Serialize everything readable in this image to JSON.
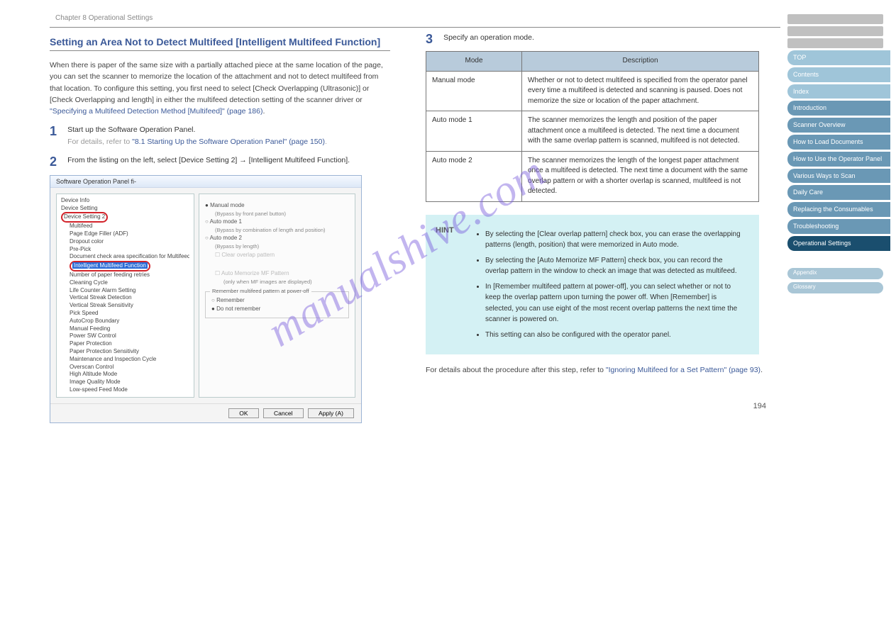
{
  "topbar": "Chapter 8 Operational Settings",
  "title": "Setting an Area Not to Detect Multifeed [Intelligent Multifeed Function]",
  "intro1": "When there is paper of the same size with a partially attached piece at the same location of the page, you can set the scanner to memorize the location of the attachment and not to detect multifeed from that location. To configure this setting, you first need to select [Check Overlapping (Ultrasonic)] or [Check Overlapping and length] in either the multifeed detection setting of the scanner driver or ",
  "intro1_link": "\"Specifying a Multifeed Detection Method [Multifeed]\" (page 186)",
  "intro1_end": ".",
  "step1": {
    "n": "1",
    "text": "Start up the Software Operation Panel.",
    "sub": "For details, refer to ",
    "sublink": "\"8.1 Starting Up the Software Operation Panel\" (page 150)",
    "subend": "."
  },
  "step2": {
    "n": "2",
    "pre": "From the listing on the left, select [Device Setting 2] ",
    "arrow": "→",
    "post": " [Intelligent Multifeed Function]."
  },
  "dlg": {
    "title": "Software Operation Panel fi-",
    "tree": [
      "Device Info",
      "Device Setting",
      "Device Setting 2",
      "Multifeed",
      "Page Edge Filler (ADF)",
      "Dropout color",
      "Pre-Pick",
      "Document check area specification for Multifeed Detection",
      "Intelligent Multifeed Function",
      "Number of paper feeding retries",
      "Cleaning Cycle",
      "Life Counter Alarm Setting",
      "Vertical Streak Detection",
      "Vertical Streak Sensitivity",
      "Pick Speed",
      "AutoCrop Boundary",
      "Manual Feeding",
      "Power SW Control",
      "Paper Protection",
      "Paper Protection Sensitivity",
      "Maintenance and Inspection Cycle",
      "Overscan Control",
      "High Altitude Mode",
      "Image Quality Mode",
      "Low-speed Feed Mode"
    ],
    "pane": {
      "r1": "Manual mode",
      "r1s": "(Bypass by front panel button)",
      "r2": "Auto mode 1",
      "r2s": "(Bypass by combination of length and position)",
      "r3": "Auto mode 2",
      "r3s": "(Bypass by length)",
      "c1": "Clear overlap pattern",
      "c2": "Auto Memorize MF Pattern",
      "c2s": "(only when MF images are displayed)",
      "grp": "Remember multifeed pattern at power-off",
      "g1": "Remember",
      "g2": "Do not remember"
    },
    "btns": {
      "ok": "OK",
      "cancel": "Cancel",
      "apply": "Apply (A)"
    }
  },
  "step3": {
    "n": "3",
    "text": "Specify an operation mode."
  },
  "table": {
    "h1": "Mode",
    "h2": "Description",
    "r1m": "Manual mode",
    "r1d": "Whether or not to detect multifeed is specified from the operator panel every time a multifeed is detected and scanning is paused. Does not memorize the size or location of the paper attachment.",
    "r2m": "Auto mode 1",
    "r2d": "The scanner memorizes the length and position of the paper attachment once a multifeed is detected. The next time a document with the same overlap pattern is scanned, multifeed is not detected.",
    "r3m": "Auto mode 2",
    "r3d": "The scanner memorizes the length of the longest paper attachment once a multifeed is detected. The next time a document with the same overlap pattern or with a shorter overlap is scanned, multifeed is not detected."
  },
  "hint": {
    "label": "HINT",
    "b1": "By selecting the [Clear overlap pattern] check box, you can erase the overlapping patterns (length, position) that were memorized in Auto mode.",
    "b2": "By selecting the [Auto Memorize MF Pattern] check box, you can record the overlap pattern in the window to check an image that was detected as multifeed.",
    "b3": "In [Remember multifeed pattern at power-off], you can select whether or not to keep the overlap pattern upon turning the power off. When [Remember] is selected, you can use eight of the most recent overlap patterns the next time the scanner is powered on.",
    "b4": "This setting can also be configured with the operator panel."
  },
  "footer": {
    "text": "For details about the procedure after this step, refer to ",
    "link": "\"Ignoring Multifeed for a Set Pattern\" (page 93)",
    "end": "."
  },
  "nav": {
    "items": [
      {
        "cls": "nav-light",
        "t": "TOP"
      },
      {
        "cls": "nav-light",
        "t": "Contents"
      },
      {
        "cls": "nav-light",
        "t": "Index"
      },
      {
        "cls": "nav-med",
        "t": "Introduction"
      },
      {
        "cls": "nav-med",
        "t": "Scanner Overview"
      },
      {
        "cls": "nav-med",
        "t": "How to Load Documents"
      },
      {
        "cls": "nav-med",
        "t": "How to Use the Operator Panel"
      },
      {
        "cls": "nav-med",
        "t": "Various Ways to Scan"
      },
      {
        "cls": "nav-med",
        "t": "Daily Care"
      },
      {
        "cls": "nav-med",
        "t": "Replacing the Consumables"
      },
      {
        "cls": "nav-med",
        "t": "Troubleshooting"
      },
      {
        "cls": "nav-dark",
        "t": "Operational Settings"
      }
    ],
    "pills": [
      "Appendix",
      "Glossary"
    ]
  },
  "page": "194",
  "watermark": "manualshive.com"
}
